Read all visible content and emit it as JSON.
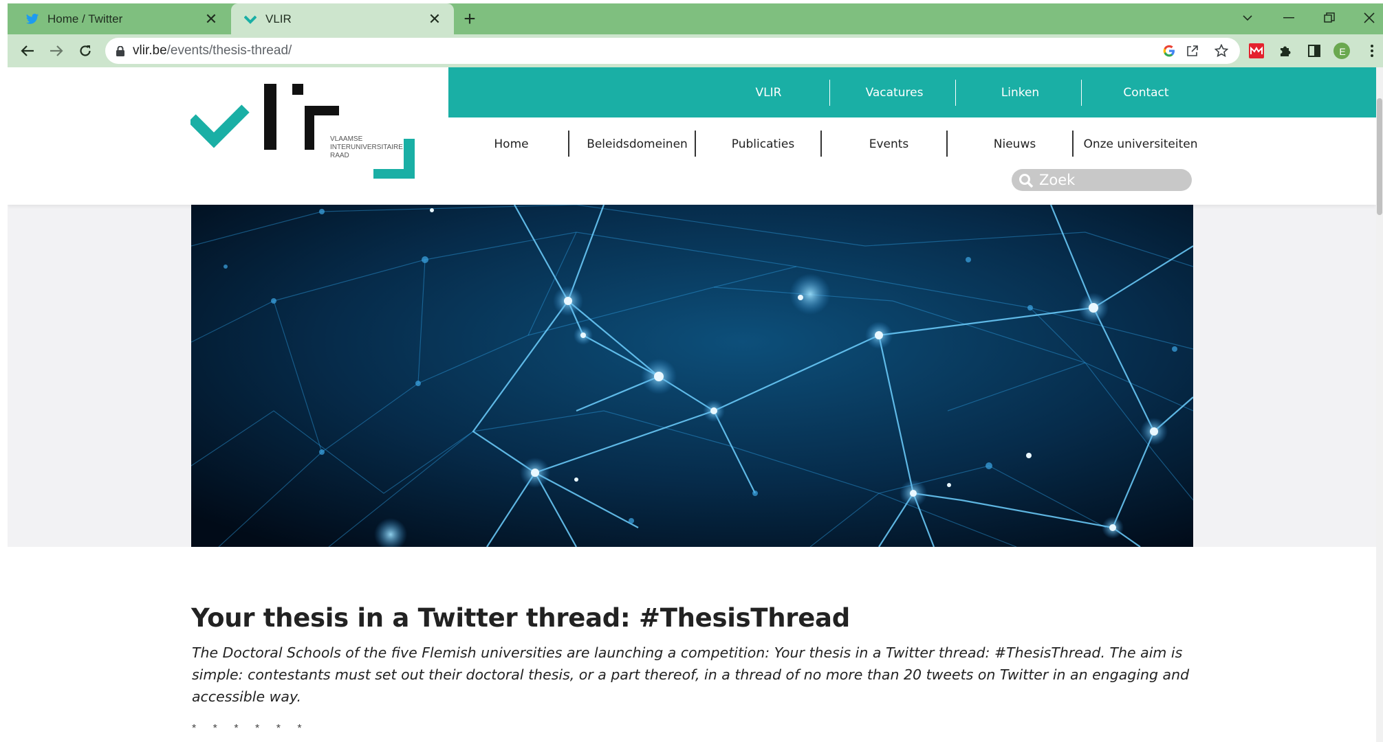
{
  "browser": {
    "tabs": [
      {
        "title": "Home / Twitter",
        "favicon": "twitter-bird-icon",
        "active": false
      },
      {
        "title": "VLIR",
        "favicon": "vlir-check-icon",
        "active": true
      }
    ],
    "new_tab_symbol": "+",
    "close_symbol": "✕",
    "url_host": "vlir.be",
    "url_path": "/events/thesis-thread/",
    "profile_initial": "E",
    "colors": {
      "frame": "#7fbf7f",
      "toolbar": "#cde5cd"
    }
  },
  "site": {
    "logo": {
      "line1": "VLAAMSE",
      "line2": "INTERUNIVERSITAIRE",
      "line3": "RAAD",
      "accent": "#1aafa5"
    },
    "top_nav": [
      "VLIR",
      "Vacatures",
      "Linken",
      "Contact"
    ],
    "main_nav": [
      "Home",
      "Beleidsdomeinen",
      "Publicaties",
      "Events",
      "Nieuws",
      "Onze universiteiten"
    ],
    "search": {
      "placeholder": "Zoek"
    },
    "colors": {
      "teal": "#1aafa5",
      "text": "#222222"
    }
  },
  "article": {
    "title": "Your thesis in a Twitter thread: #ThesisThread",
    "intro": "The Doctoral Schools of the five Flemish universities are launching a competition: Your thesis in a Twitter thread: #ThesisThread. The aim is simple: contestants must set out their doctoral thesis, or a part thereof, in a thread of no more than 20 tweets on Twitter in an engaging and accessible way.",
    "separator": "* * * * * *"
  }
}
